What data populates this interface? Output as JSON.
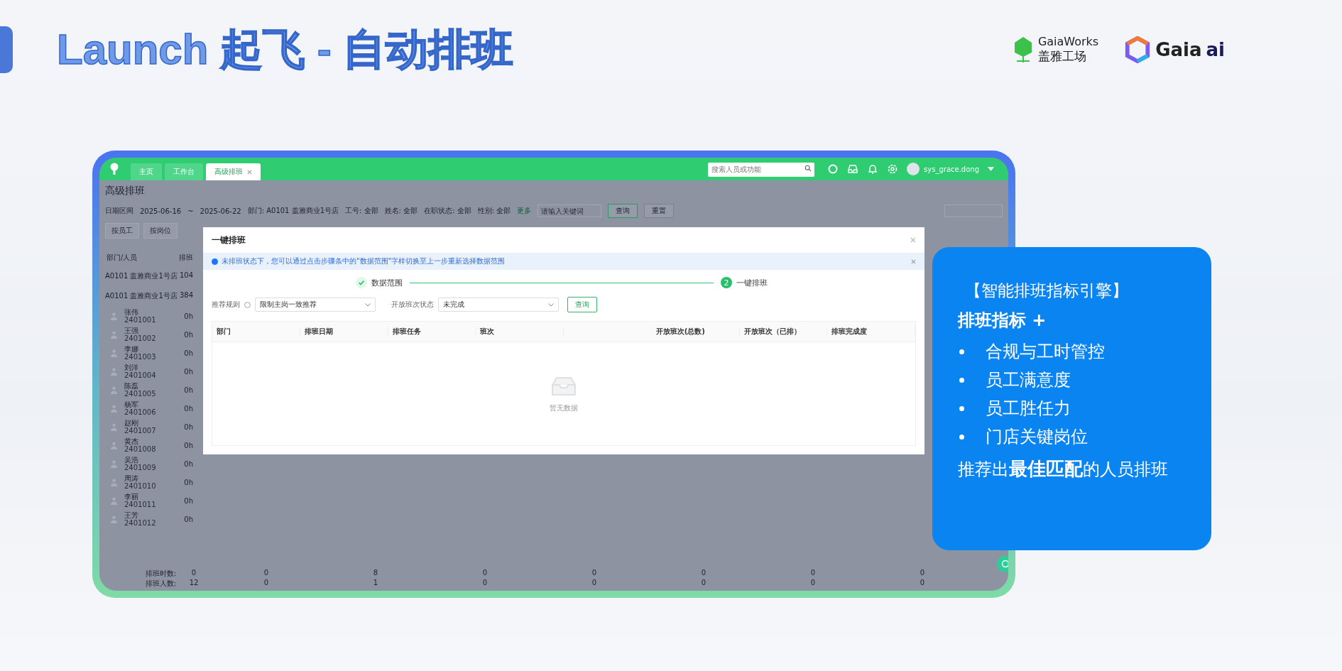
{
  "slide": {
    "title": "Launch 起飞 - 自动排班"
  },
  "logos": {
    "gaiaworks": {
      "name": "GaiaWorks",
      "subtitle": "盖雅工场"
    },
    "gaia_ai": {
      "name": "Gaia",
      "suffix": "ai"
    }
  },
  "app": {
    "tabs": [
      {
        "label": "主页",
        "selected": false,
        "closable": false
      },
      {
        "label": "工作台",
        "selected": false,
        "closable": false
      },
      {
        "label": "高级排班",
        "selected": true,
        "closable": true
      }
    ],
    "search": {
      "placeholder": "搜索人员或功能"
    },
    "user": "sys_grace.dong",
    "page_title": "高级排班",
    "filters": {
      "date_label": "日期区间",
      "date_from": "2025-06-16",
      "date_sep": "~",
      "date_to": "2025-06-22",
      "selects": [
        "部门: A0101 盖雅商业1号店",
        "工号: 全部",
        "姓名: 全部",
        "在职状态: 全部",
        "性别: 全部"
      ],
      "more": "更多",
      "keyword_placeholder": "请输入关键词",
      "buttons": [
        "查询",
        "重置"
      ]
    },
    "view_buttons": [
      "按员工",
      "按岗位"
    ],
    "list_header": [
      "部门/人员",
      "排班"
    ],
    "stores": [
      {
        "name": "A0101 盖雅商业1号店",
        "value": "104"
      },
      {
        "name": "A0101 盖雅商业1号店",
        "value": "384"
      }
    ],
    "employees": [
      {
        "name": "张伟",
        "id": "2401001",
        "hours": "0h"
      },
      {
        "name": "王强",
        "id": "2401002",
        "hours": "0h"
      },
      {
        "name": "李娜",
        "id": "2401003",
        "hours": "0h"
      },
      {
        "name": "刘洋",
        "id": "2401004",
        "hours": "0h"
      },
      {
        "name": "陈磊",
        "id": "2401005",
        "hours": "0h"
      },
      {
        "name": "杨军",
        "id": "2401006",
        "hours": "0h"
      },
      {
        "name": "赵刚",
        "id": "2401007",
        "hours": "0h"
      },
      {
        "name": "黄杰",
        "id": "2401008",
        "hours": "0h"
      },
      {
        "name": "吴浩",
        "id": "2401009",
        "hours": "0h"
      },
      {
        "name": "周涛",
        "id": "2401010",
        "hours": "0h"
      },
      {
        "name": "李丽",
        "id": "2401011",
        "hours": "0h"
      },
      {
        "name": "王芳",
        "id": "2401012",
        "hours": "0h"
      }
    ],
    "totals": [
      {
        "label": "排班时数:",
        "values": [
          "0",
          "0",
          "8",
          "0",
          "0",
          "0",
          "0",
          "0"
        ]
      },
      {
        "label": "排班人数:",
        "values": [
          "12",
          "0",
          "1",
          "0",
          "0",
          "0",
          "0",
          "0"
        ]
      }
    ]
  },
  "modal": {
    "title": "一键排班",
    "alert": "未排班状态下，您可以通过点击步骤条中的\"数据范围\"字样切换至上一步重新选择数据范围",
    "steps": [
      {
        "label": "数据范围",
        "done": true
      },
      {
        "label": "一键排班",
        "done": false,
        "number": "2"
      }
    ],
    "rule_label": "推荐规则",
    "rule_value": "限制主岗一致推荐",
    "status_label": "开放班次状态",
    "status_value": "未完成",
    "query_button": "查询",
    "columns": [
      "部门",
      "排班日期",
      "排班任务",
      "班次",
      "",
      "开放班次(总数)",
      "开放班次（已排）",
      "排班完成度"
    ],
    "empty_text": "暂无数据"
  },
  "panel": {
    "heading": "【智能排班指标引擎】",
    "subheading": "排班指标 +",
    "bullets": [
      "合规与工时管控",
      "员工满意度",
      "员工胜任力",
      "门店关键岗位"
    ],
    "footer": "推荐出**最佳匹配**的人员排班"
  }
}
